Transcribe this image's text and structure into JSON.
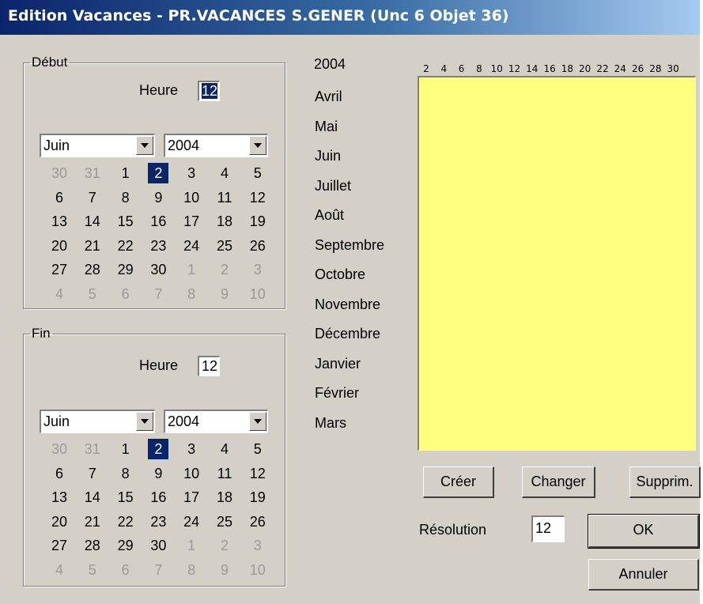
{
  "window": {
    "title": "Edition Vacances - PR.VACANCES S.GENER (Unc 6 Objet 36)"
  },
  "debut": {
    "legend": "Début",
    "heure_label": "Heure",
    "heure_value": "12",
    "month": "Juin",
    "year": "2004",
    "days": [
      [
        "30",
        "31",
        "1",
        "2",
        "3",
        "4",
        "5"
      ],
      [
        "6",
        "7",
        "8",
        "9",
        "10",
        "11",
        "12"
      ],
      [
        "13",
        "14",
        "15",
        "16",
        "17",
        "18",
        "19"
      ],
      [
        "20",
        "21",
        "22",
        "23",
        "24",
        "25",
        "26"
      ],
      [
        "27",
        "28",
        "29",
        "30",
        "1",
        "2",
        "3"
      ],
      [
        "4",
        "5",
        "6",
        "7",
        "8",
        "9",
        "10"
      ]
    ],
    "selected_day": "2"
  },
  "fin": {
    "legend": "Fin",
    "heure_label": "Heure",
    "heure_value": "12",
    "month": "Juin",
    "year": "2004",
    "days": [
      [
        "30",
        "31",
        "1",
        "2",
        "3",
        "4",
        "5"
      ],
      [
        "6",
        "7",
        "8",
        "9",
        "10",
        "11",
        "12"
      ],
      [
        "13",
        "14",
        "15",
        "16",
        "17",
        "18",
        "19"
      ],
      [
        "20",
        "21",
        "22",
        "23",
        "24",
        "25",
        "26"
      ],
      [
        "27",
        "28",
        "29",
        "30",
        "1",
        "2",
        "3"
      ],
      [
        "4",
        "5",
        "6",
        "7",
        "8",
        "9",
        "10"
      ]
    ],
    "selected_day": "2"
  },
  "year_label": "2004",
  "months": [
    "Avril",
    "Mai",
    "Juin",
    "Juillet",
    "Août",
    "Septembre",
    "Octobre",
    "Novembre",
    "Décembre",
    "Janvier",
    "Février",
    "Mars"
  ],
  "day_axis": [
    "2",
    "4",
    "6",
    "8",
    "10",
    "12",
    "14",
    "16",
    "18",
    "20",
    "22",
    "24",
    "26",
    "28",
    "30"
  ],
  "buttons": {
    "creer": "Créer",
    "changer": "Changer",
    "supprim": "Supprim.",
    "ok": "OK",
    "annuler": "Annuler"
  },
  "resolution": {
    "label": "Résolution",
    "value": "12"
  },
  "colors": {
    "chart_bg": "#ffff80",
    "selection": "#0a246a",
    "face": "#d4d0c8"
  }
}
